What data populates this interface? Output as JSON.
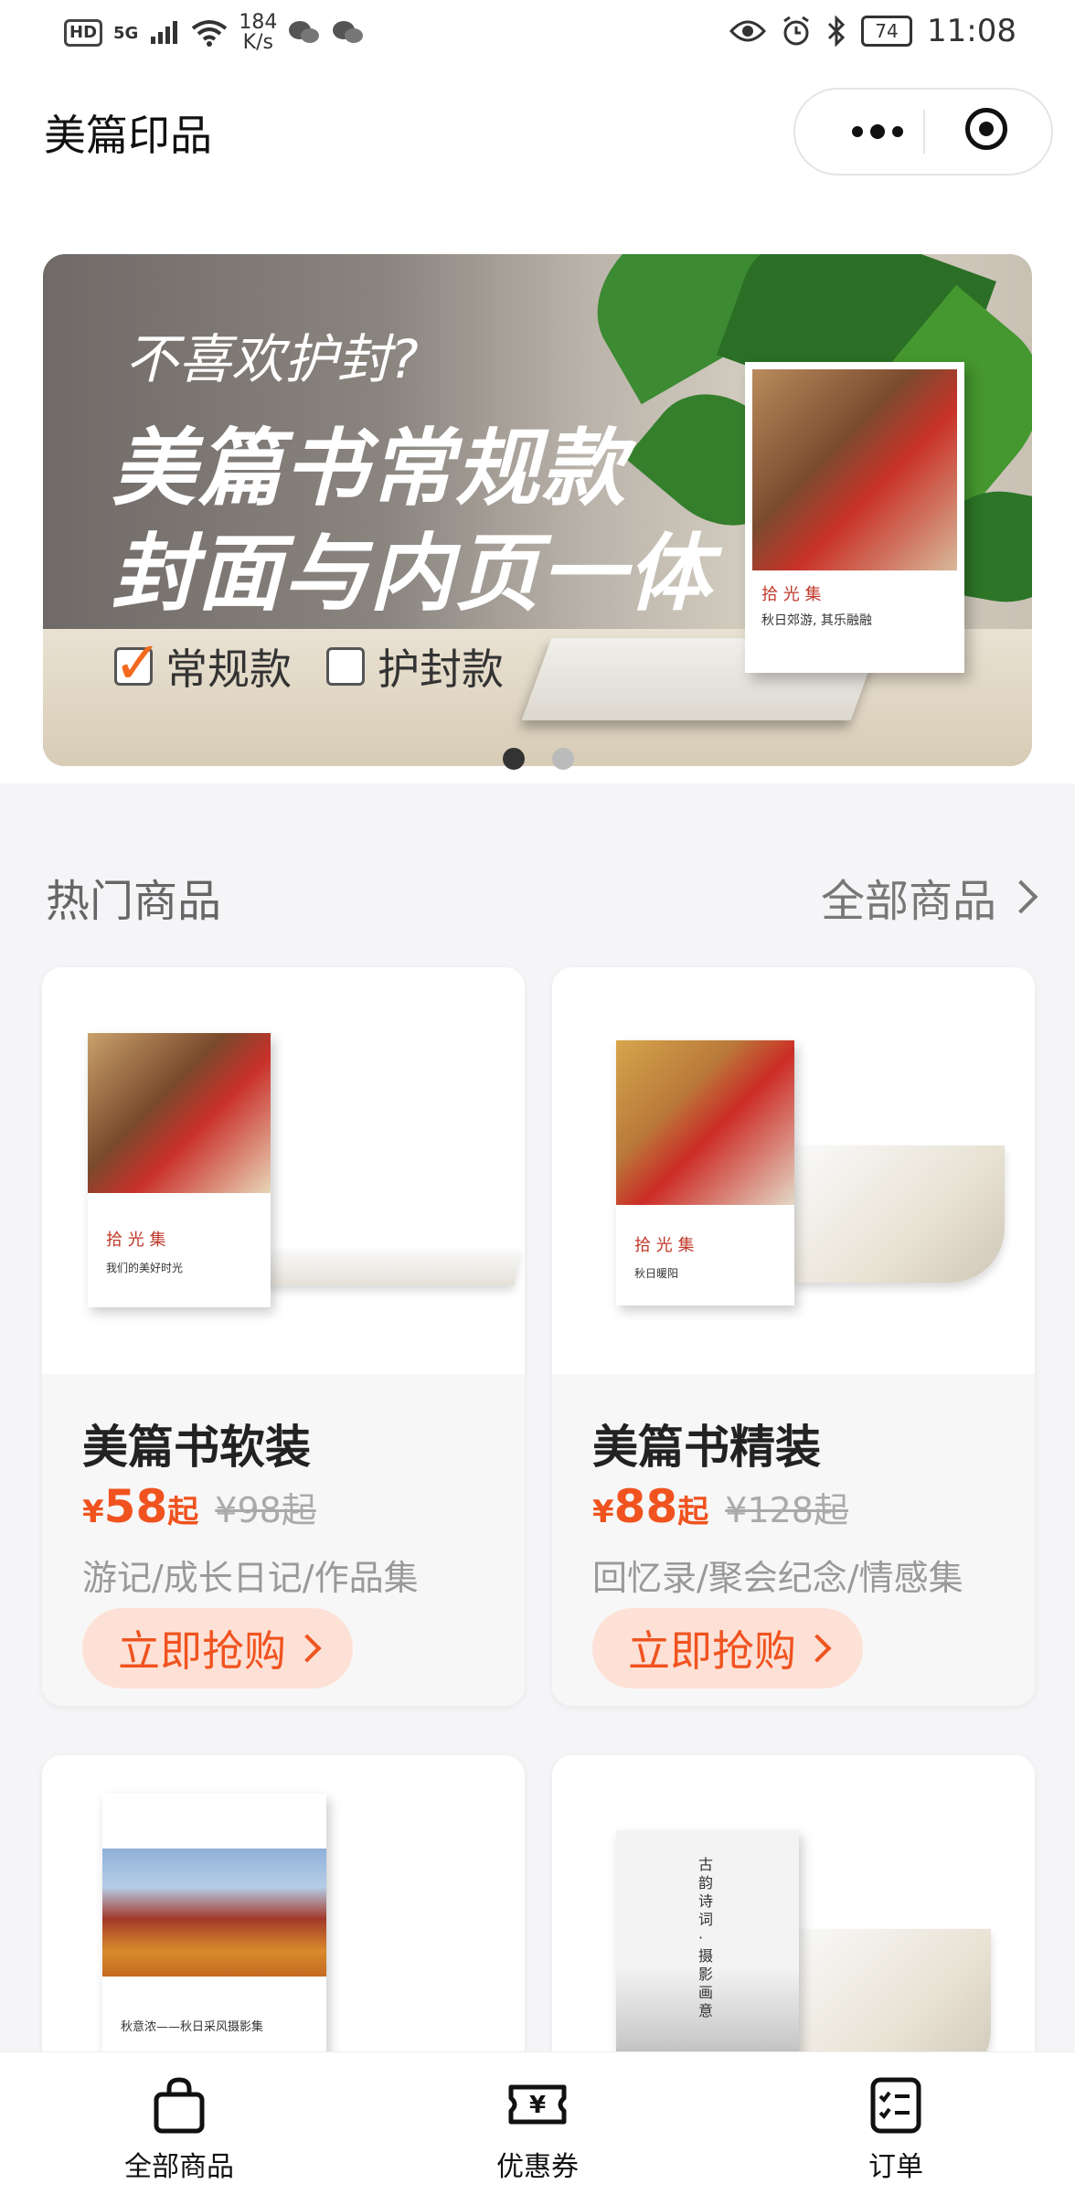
{
  "status": {
    "hd": "HD",
    "network": "5G",
    "speed_value": "184",
    "speed_unit": "K/s",
    "battery": "74",
    "time": "11:08"
  },
  "nav": {
    "title": "美篇印品",
    "more_icon": "more-icon",
    "close_icon": "target-icon"
  },
  "banner": {
    "question": "不喜欢护封?",
    "headline1": "美篇书常规款",
    "headline2": "封面与内页一体",
    "option_regular": "常规款",
    "option_jacket": "护封款",
    "book_title": "拾 光 集",
    "book_subtitle": "秋日郊游, 其乐融融",
    "slides": 2,
    "active_slide": 1
  },
  "section": {
    "title": "热门商品",
    "all_link": "全部商品"
  },
  "products": [
    {
      "name": "美篇书软装",
      "price_symbol": "¥",
      "price": "58",
      "price_suffix": "起",
      "old_price": "¥98起",
      "tags": "游记/成长日记/作品集",
      "buy_label": "立即抢购",
      "cover_title": "拾 光 集",
      "cover_subtitle": "我们的美好时光"
    },
    {
      "name": "美篇书精装",
      "price_symbol": "¥",
      "price": "88",
      "price_suffix": "起",
      "old_price": "¥128起",
      "tags": "回忆录/聚会纪念/情感集",
      "buy_label": "立即抢购",
      "cover_title": "拾 光 集",
      "cover_subtitle": "秋日暖阳"
    },
    {
      "cover_subtitle": "秋意浓——秋日采风摄影集"
    },
    {
      "cover_title": "古韵诗词 · 摄影画意"
    }
  ],
  "tabbar": [
    {
      "label": "全部商品",
      "icon": "shopping-bag-icon"
    },
    {
      "label": "优惠券",
      "icon": "coupon-icon"
    },
    {
      "label": "订单",
      "icon": "order-list-icon"
    }
  ],
  "colors": {
    "accent": "#f0531f",
    "accent_bg": "#fde1d6",
    "page_bg": "#f5f5f7"
  }
}
